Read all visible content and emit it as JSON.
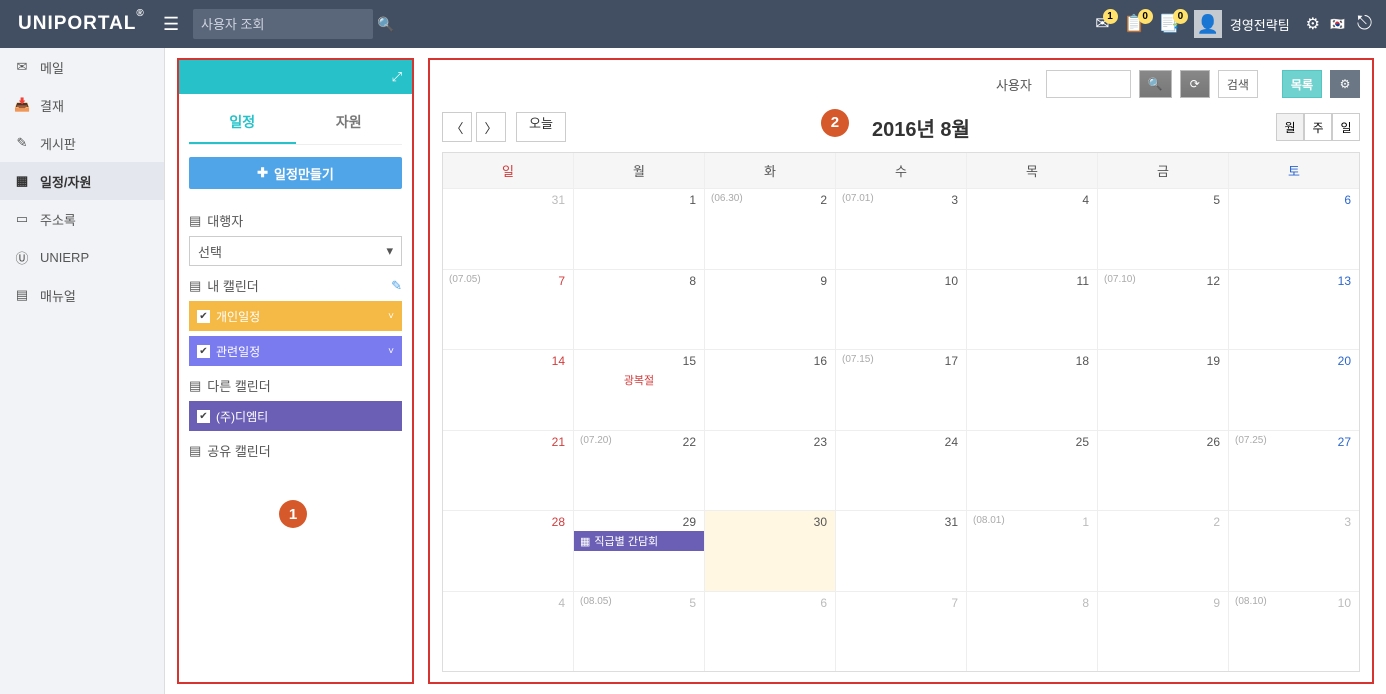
{
  "header": {
    "logo": "UNIPORTAL",
    "search_placeholder": "사용자 조회",
    "badges": {
      "mail": "1",
      "approval": "0",
      "clipboard": "0"
    },
    "user_name": "경영전략팀"
  },
  "nav": {
    "items": [
      {
        "label": "메일"
      },
      {
        "label": "결재"
      },
      {
        "label": "게시판"
      },
      {
        "label": "일정/자원"
      },
      {
        "label": "주소록"
      },
      {
        "label": "UNIERP"
      },
      {
        "label": "매뉴얼"
      }
    ]
  },
  "panel1": {
    "tabs": {
      "schedule": "일정",
      "resource": "자원"
    },
    "create_label": "일정만들기",
    "proxy_title": "대행자",
    "proxy_value": "선택",
    "my_cal_title": "내 캘린더",
    "cal_personal": "개인일정",
    "cal_related": "관련일정",
    "other_cal_title": "다른 캘린더",
    "cal_company": "(주)디엠티",
    "shared_cal_title": "공유 캘린더",
    "callout": "1"
  },
  "panel2": {
    "user_label": "사용자",
    "search_label": "검색",
    "list_label": "목록",
    "today_label": "오늘",
    "title": "2016년 8월",
    "views": {
      "month": "월",
      "week": "주",
      "day": "일"
    },
    "dow": [
      "일",
      "월",
      "화",
      "수",
      "목",
      "금",
      "토"
    ],
    "callout": "2",
    "weeks": [
      [
        {
          "n": "31",
          "out": true,
          "sun": true
        },
        {
          "n": "1"
        },
        {
          "n": "2",
          "lunar": "(06.30)"
        },
        {
          "n": "3",
          "lunar": "(07.01)"
        },
        {
          "n": "4"
        },
        {
          "n": "5"
        },
        {
          "n": "6",
          "sat": true
        }
      ],
      [
        {
          "n": "7",
          "sun": true,
          "lunar": "(07.05)"
        },
        {
          "n": "8"
        },
        {
          "n": "9"
        },
        {
          "n": "10"
        },
        {
          "n": "11"
        },
        {
          "n": "12",
          "lunar": "(07.10)"
        },
        {
          "n": "13",
          "sat": true
        }
      ],
      [
        {
          "n": "14",
          "sun": true
        },
        {
          "n": "15",
          "holiday": "광복절"
        },
        {
          "n": "16"
        },
        {
          "n": "17",
          "lunar": "(07.15)"
        },
        {
          "n": "18"
        },
        {
          "n": "19"
        },
        {
          "n": "20",
          "sat": true
        }
      ],
      [
        {
          "n": "21",
          "sun": true
        },
        {
          "n": "22",
          "lunar": "(07.20)"
        },
        {
          "n": "23"
        },
        {
          "n": "24"
        },
        {
          "n": "25"
        },
        {
          "n": "26"
        },
        {
          "n": "27",
          "sat": true,
          "lunar": "(07.25)"
        }
      ],
      [
        {
          "n": "28",
          "sun": true
        },
        {
          "n": "29",
          "event": "직급별 간담회"
        },
        {
          "n": "30",
          "today": true
        },
        {
          "n": "31"
        },
        {
          "n": "1",
          "out": true,
          "lunar": "(08.01)"
        },
        {
          "n": "2",
          "out": true
        },
        {
          "n": "3",
          "out": true
        }
      ],
      [
        {
          "n": "4",
          "out": true,
          "sun": true
        },
        {
          "n": "5",
          "out": true,
          "lunar": "(08.05)"
        },
        {
          "n": "6",
          "out": true
        },
        {
          "n": "7",
          "out": true
        },
        {
          "n": "8",
          "out": true
        },
        {
          "n": "9",
          "out": true
        },
        {
          "n": "10",
          "out": true,
          "lunar": "(08.10)"
        }
      ]
    ]
  }
}
